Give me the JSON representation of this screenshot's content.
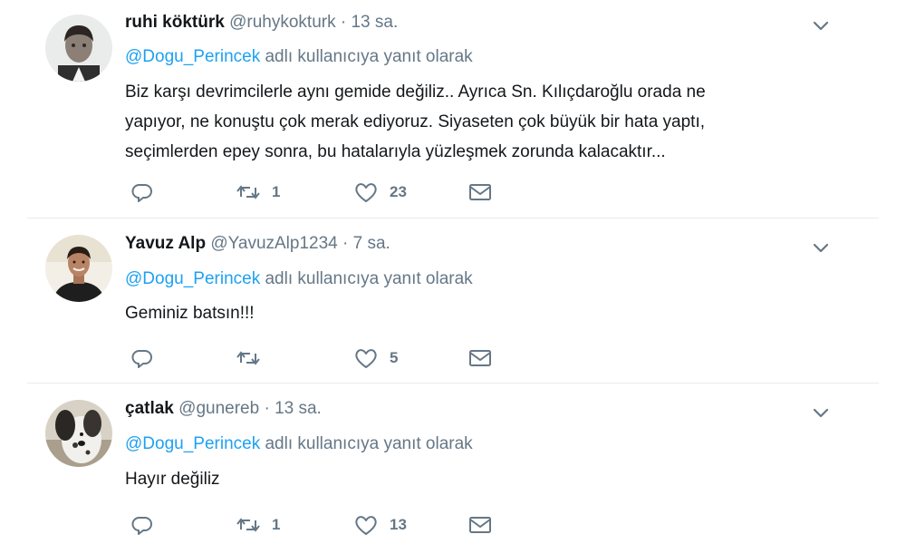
{
  "tweets": [
    {
      "name": "ruhi köktürk",
      "handle": "@ruhykokturk",
      "separator": "·",
      "time": "13 sa.",
      "reply_prefix": "@Dogu_Perincek",
      "reply_suffix": " adlı kullanıcıya yanıt olarak",
      "text_lines": [
        "Biz karşı devrimcilerle aynı gemide değiliz.. Ayrıca Sn. Kılıçdaroğlu orada ne",
        "yapıyor, ne konuştu çok merak ediyoruz. Siyaseten çok büyük bir hata yaptı,",
        "seçimlerden epey sonra, bu hatalarıyla yüzleşmek zorunda kalacaktır..."
      ],
      "retweets": "1",
      "likes": "23",
      "avatar_icon": "child-portrait-photo"
    },
    {
      "name": "Yavuz Alp",
      "handle": "@YavuzAlp1234",
      "separator": "·",
      "time": "7 sa.",
      "reply_prefix": "@Dogu_Perincek",
      "reply_suffix": " adlı kullanıcıya yanıt olarak",
      "text_lines": [
        "Geminiz batsın!!!"
      ],
      "retweets": "",
      "likes": "5",
      "avatar_icon": "man-portrait-photo"
    },
    {
      "name": "çatlak",
      "handle": "@gunereb",
      "separator": "·",
      "time": "13 sa.",
      "reply_prefix": "@Dogu_Perincek",
      "reply_suffix": " adlı kullanıcıya yanıt olarak",
      "text_lines": [
        "Hayır değiliz"
      ],
      "retweets": "1",
      "likes": "13",
      "avatar_icon": "dog-photo"
    }
  ],
  "colors": {
    "accent": "#1da1f2",
    "muted": "#657786",
    "text": "#14171a",
    "divider": "#e6ecf0"
  },
  "icons": [
    "reply-icon",
    "retweet-icon",
    "like-icon",
    "direct-message-icon",
    "caret-down-icon"
  ]
}
